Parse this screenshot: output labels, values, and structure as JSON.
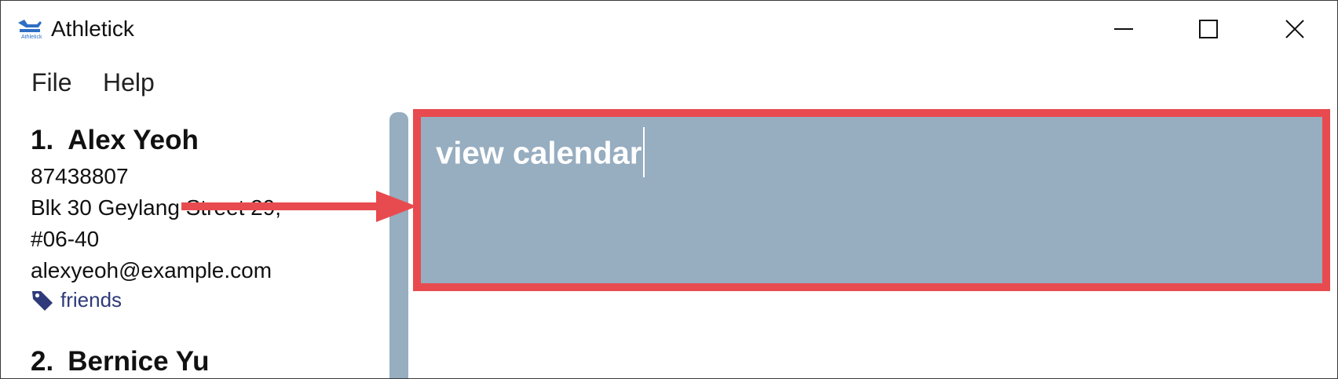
{
  "window": {
    "title": "Athletick",
    "icon_name": "athletick-logo-icon",
    "controls": [
      "minimize",
      "maximize",
      "close"
    ]
  },
  "menu": {
    "items": [
      {
        "label": "File"
      },
      {
        "label": "Help"
      }
    ]
  },
  "persons": [
    {
      "index": "1.",
      "name": "Alex Yeoh",
      "phone": "87438807",
      "address_line1": "Blk 30 Geylang Street 29,",
      "address_line2": "#06-40",
      "email": "alexyeoh@example.com",
      "tag": "friends"
    },
    {
      "index": "2.",
      "name": "Bernice Yu"
    }
  ],
  "result_display": {
    "text": "view calendar"
  },
  "colors": {
    "accent_blue": "#97adc0",
    "highlight_red": "#e84b4f",
    "tag_text": "#2e3a7a",
    "tag_icon": "#2e3a7a"
  }
}
